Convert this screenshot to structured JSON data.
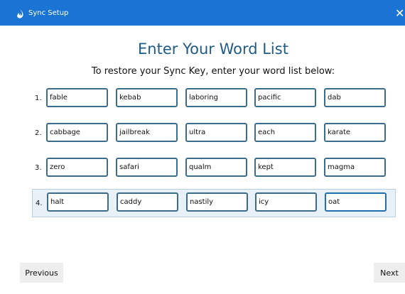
{
  "window": {
    "title": "Sync Setup",
    "close_glyph": "✕",
    "icon": "app-icon"
  },
  "heading": "Enter Your Word List",
  "instruction": "To restore your Sync Key, enter your word list below:",
  "rows": [
    {
      "number": "1.",
      "words": [
        "fable",
        "kebab",
        "laboring",
        "pacific",
        "dab"
      ]
    },
    {
      "number": "2.",
      "words": [
        "cabbage",
        "jailbreak",
        "ultra",
        "each",
        "karate"
      ]
    },
    {
      "number": "3.",
      "words": [
        "zero",
        "safari",
        "qualm",
        "kept",
        "magma"
      ]
    },
    {
      "number": "4.",
      "words": [
        "halt",
        "caddy",
        "nastily",
        "icy",
        "oat"
      ]
    }
  ],
  "active_row": 4,
  "buttons": {
    "previous": "Previous",
    "next": "Next"
  },
  "colors": {
    "titlebar": "#1b73d3",
    "heading": "#1f5c85",
    "input_border": "#3b6c8a",
    "active_row_bg": "#e8f1f8"
  }
}
